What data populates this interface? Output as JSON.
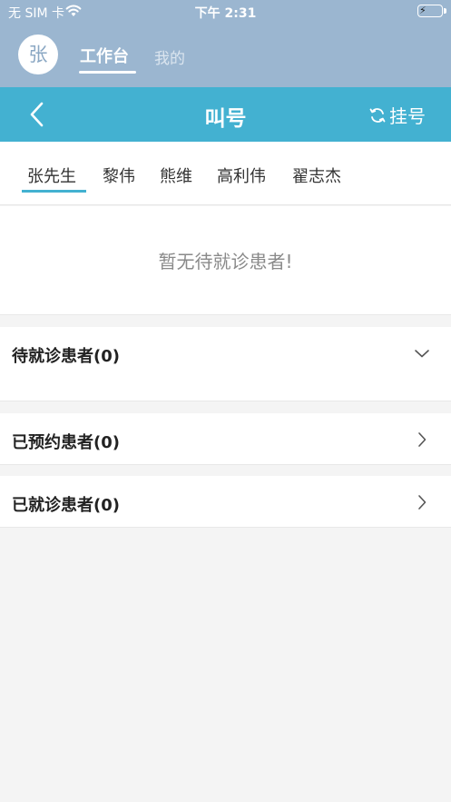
{
  "status_bar": {
    "carrier": "无 SIM 卡",
    "time": "下午 2:31"
  },
  "header": {
    "avatar_text": "张",
    "tab_active": "工作台",
    "tab_inactive": "我的"
  },
  "navbar": {
    "title": "叫号",
    "register_label": "挂号"
  },
  "doctor_tabs": [
    "张先生",
    "黎伟",
    "熊维",
    "高利伟",
    "翟志杰"
  ],
  "empty_message": "暂无待就诊患者!",
  "sections": {
    "waiting": "待就诊患者(0)",
    "booked": "已预约患者(0)",
    "visited": "已就诊患者(0)"
  },
  "colors": {
    "header_bg": "#9bb6d0",
    "nav_bg": "#43b1d1",
    "battery": "#4cd964"
  }
}
